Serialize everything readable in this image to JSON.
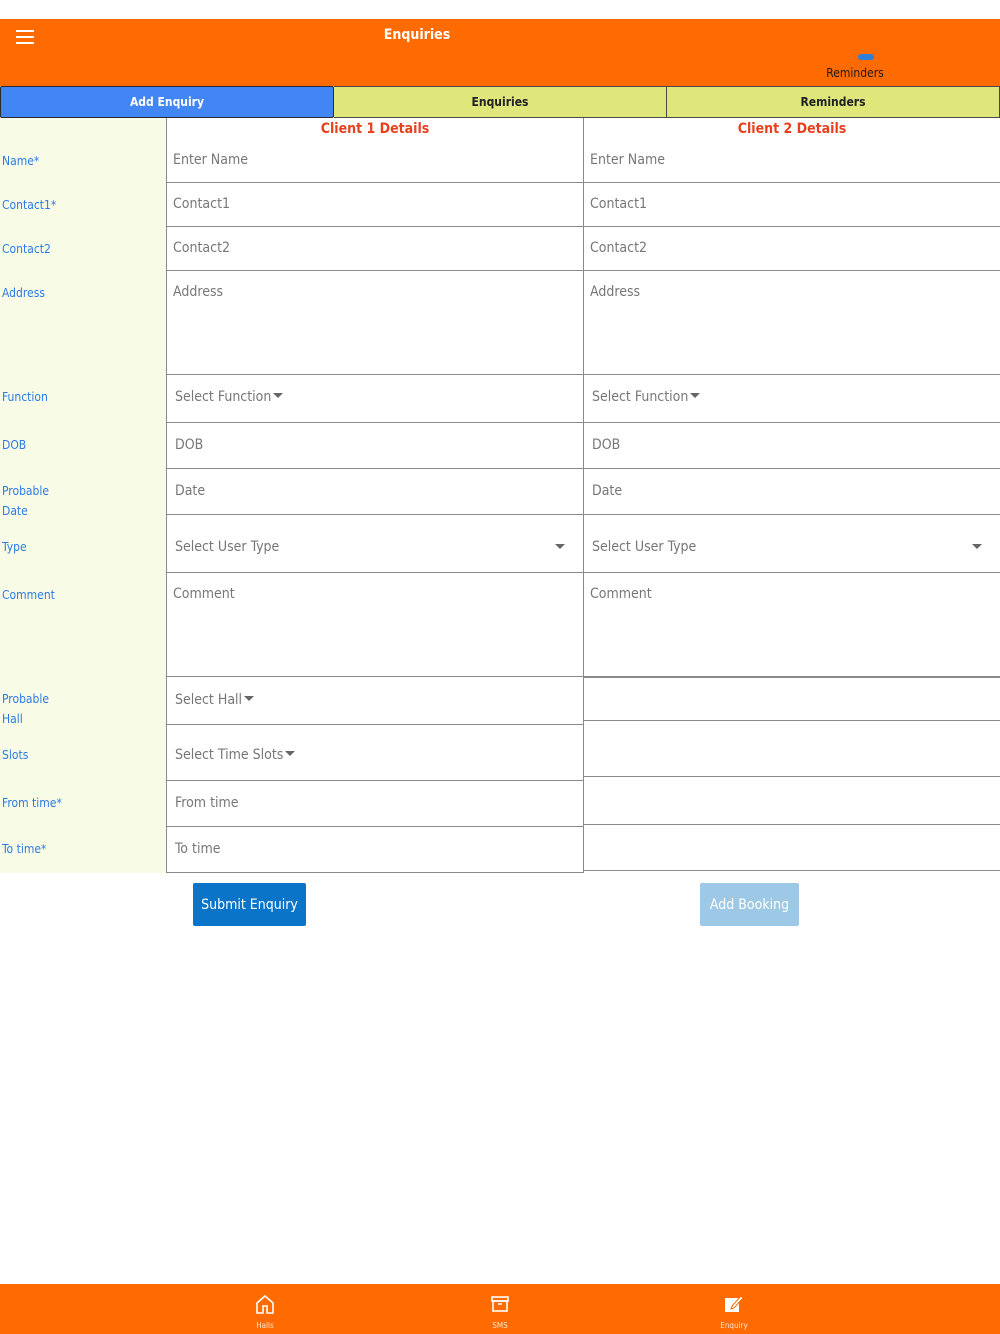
{
  "header": {
    "title": "Enquiries",
    "reminders_label": "Reminders"
  },
  "tabs": [
    {
      "label": "Add Enquiry",
      "active": true
    },
    {
      "label": "Enquiries",
      "active": false
    },
    {
      "label": "Reminders",
      "active": false
    }
  ],
  "form": {
    "labels": {
      "name": "Name*",
      "contact1": "Contact1*",
      "contact2": "Contact2",
      "address": "Address",
      "function": "Function",
      "dob": "DOB",
      "probable_date_1": "Probable",
      "probable_date_2": "Date",
      "type": "Type",
      "comment": "Comment",
      "probable_hall_1": "Probable",
      "probable_hall_2": "Hall",
      "slots": "Slots",
      "from_time": "From time*",
      "to_time": "To time*"
    },
    "client1": {
      "heading": "Client 1 Details",
      "name_placeholder": "Enter Name",
      "contact1_placeholder": "Contact1",
      "contact2_placeholder": "Contact2",
      "address_placeholder": "Address",
      "function_select": "Select Function",
      "dob_placeholder": "DOB",
      "date_placeholder": "Date",
      "type_select": "Select User Type",
      "comment_placeholder": "Comment",
      "hall_select": "Select Hall",
      "slots_select": "Select Time Slots",
      "from_time_placeholder": "From time",
      "to_time_placeholder": "To time"
    },
    "client2": {
      "heading": "Client 2 Details",
      "name_placeholder": "Enter Name",
      "contact1_placeholder": "Contact1",
      "contact2_placeholder": "Contact2",
      "address_placeholder": "Address",
      "function_select": "Select Function",
      "dob_placeholder": "DOB",
      "date_placeholder": "Date",
      "type_select": "Select User Type",
      "comment_placeholder": "Comment"
    }
  },
  "buttons": {
    "submit": "Submit Enquiry",
    "add_booking": "Add Booking"
  },
  "bottom_nav": [
    {
      "label": "Halls",
      "icon": "home-icon"
    },
    {
      "label": "SMS",
      "icon": "archive-icon"
    },
    {
      "label": "Enquiry",
      "icon": "edit-icon"
    }
  ],
  "colors": {
    "primary": "#ff6b00",
    "tab_active": "#4285f4",
    "tab_inactive": "#e0e77a",
    "label": "#2c7be5",
    "heading": "#e8401c",
    "submit": "#0a74c8",
    "booking": "#9ec9e6"
  }
}
